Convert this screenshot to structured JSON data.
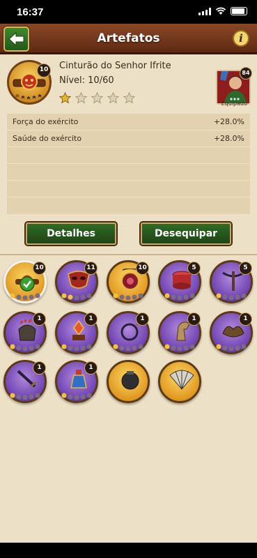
{
  "status_bar": {
    "time": "16:37"
  },
  "header": {
    "title": "Artefatos",
    "info_label": "i"
  },
  "artifact": {
    "name": "Cinturão do Senhor Ifrite",
    "level_text": "Nível: 10/60",
    "badge_level": "10",
    "stars_filled": 1,
    "stars_total": 5
  },
  "hero": {
    "level": "84",
    "equipped_label": "Equipado"
  },
  "stats": [
    {
      "label": "Força do exército",
      "value": "+28.0%"
    },
    {
      "label": "Saúde do exército",
      "value": "+28.0%"
    }
  ],
  "empty_stat_rows": 4,
  "buttons": {
    "details": "Detalhes",
    "unequip": "Desequipar"
  },
  "items": [
    {
      "name": "belt",
      "level": "10",
      "type": "gold",
      "selected": true
    },
    {
      "name": "mask",
      "level": "11",
      "type": "purple"
    },
    {
      "name": "amulet",
      "level": "10",
      "type": "gold"
    },
    {
      "name": "drum",
      "level": "5",
      "type": "purple"
    },
    {
      "name": "crossbow",
      "level": "5",
      "type": "purple"
    },
    {
      "name": "helmet",
      "level": "1",
      "type": "purple"
    },
    {
      "name": "lantern",
      "level": "1",
      "type": "purple"
    },
    {
      "name": "lute",
      "level": "1",
      "type": "purple"
    },
    {
      "name": "horse-head",
      "level": "1",
      "type": "purple"
    },
    {
      "name": "wing-shield",
      "level": "1",
      "type": "purple"
    },
    {
      "name": "dagger",
      "level": "1",
      "type": "purple"
    },
    {
      "name": "potion",
      "level": "1",
      "type": "purple"
    },
    {
      "name": "pot",
      "level": "",
      "type": "gold"
    },
    {
      "name": "fan",
      "level": "",
      "type": "gold"
    }
  ],
  "colors": {
    "header": "#6b3219",
    "green_button": "#2f6a24",
    "gold_border": "#c9a765",
    "background": "#ece0c7"
  }
}
